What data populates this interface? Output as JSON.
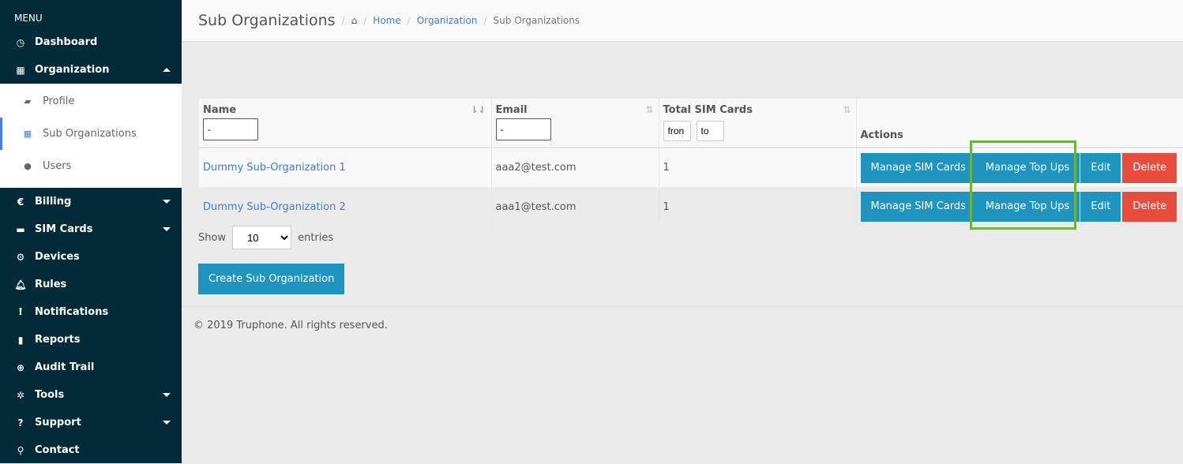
{
  "sidebar": {
    "menu_label": "MENU",
    "items": [
      {
        "label": "Dashboard",
        "icon": "dashboard-icon",
        "glyph": "◷"
      },
      {
        "label": "Organization",
        "icon": "building-icon",
        "glyph": "▦"
      },
      {
        "label": "Billing",
        "icon": "euro-icon",
        "glyph": "€"
      },
      {
        "label": "SIM Cards",
        "icon": "credit-card-icon",
        "glyph": "▬"
      },
      {
        "label": "Devices",
        "icon": "cogs-icon",
        "glyph": "⚙"
      },
      {
        "label": "Rules",
        "icon": "bell-icon",
        "glyph": "🔔︎"
      },
      {
        "label": "Notifications",
        "icon": "exclamation-circle-icon",
        "glyph": "❗︎"
      },
      {
        "label": "Reports",
        "icon": "book-icon",
        "glyph": "▮"
      },
      {
        "label": "Audit Trail",
        "icon": "search-plus-icon",
        "glyph": "⊕"
      },
      {
        "label": "Tools",
        "icon": "gear-icon",
        "glyph": "✲"
      },
      {
        "label": "Support",
        "icon": "question-icon",
        "glyph": "?"
      },
      {
        "label": "Contact",
        "icon": "map-marker-icon",
        "glyph": "⚲"
      }
    ],
    "subitems": [
      {
        "label": "Profile",
        "glyph": "▰"
      },
      {
        "label": "Sub Organizations",
        "glyph": "▦"
      },
      {
        "label": "Users",
        "glyph": "●"
      }
    ]
  },
  "header": {
    "title": "Sub Organizations",
    "breadcrumb": [
      "Home",
      "Organization",
      "Sub Organizations"
    ]
  },
  "table": {
    "columns": [
      "Name",
      "Email",
      "Total SIM Cards",
      "Actions"
    ],
    "filters": {
      "name": "-",
      "email": "-",
      "from": "fron",
      "to": "to"
    },
    "rows": [
      {
        "name": "Dummy Sub-Organization 1",
        "email": "aaa2@test.com",
        "sims": "1"
      },
      {
        "name": "Dummy Sub-Organization 2",
        "email": "aaa1@test.com",
        "sims": "1"
      }
    ],
    "actions": {
      "manage_sims": "Manage SIM Cards",
      "manage_topups": "Manage Top Ups",
      "edit": "Edit",
      "delete": "Delete"
    }
  },
  "show": {
    "label": "Show",
    "value": "10",
    "suffix": "entries"
  },
  "create_label": "Create Sub Organization",
  "footer": "© 2019 Truphone. All rights reserved.",
  "colors": {
    "sidebar": "#022a38",
    "primary": "#1e94bf",
    "danger": "#e84c3d",
    "highlight": "#6db33f",
    "link": "#3b7dd8"
  }
}
